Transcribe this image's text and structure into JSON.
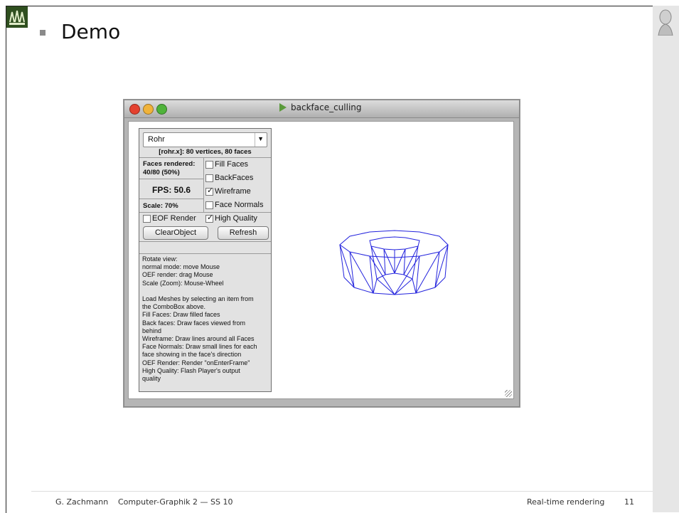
{
  "slide": {
    "title": "Demo",
    "footer": {
      "author": "G. Zachmann",
      "course": "Computer-Graphik 2 — SS 10",
      "topic": "Real-time rendering",
      "page": "11"
    },
    "logos": {
      "left": "university-seal-icon",
      "right": "bust-logo-icon"
    }
  },
  "window": {
    "title": "backface_culling",
    "controls": [
      "close-button",
      "minimize-button",
      "zoom-button"
    ]
  },
  "panel": {
    "combo_value": "Rohr",
    "mesh_info": "[rohr.x]: 80 vertices, 80 faces",
    "faces_rendered_label": "Faces rendered:",
    "faces_rendered_value": "40/80 (50%)",
    "fps": "FPS: 50.6",
    "scale": "Scale: 70%",
    "checkboxes": {
      "fill_faces": {
        "label": "Fill Faces",
        "checked": false
      },
      "back_faces": {
        "label": "BackFaces",
        "checked": false
      },
      "wireframe": {
        "label": "Wireframe",
        "checked": true
      },
      "face_normals": {
        "label": "Face Normals",
        "checked": false
      },
      "eof_render": {
        "label": "EOF Render",
        "checked": false
      },
      "high_quality": {
        "label": "High Quality",
        "checked": true
      }
    },
    "buttons": {
      "clear": "ClearObject",
      "refresh": "Refresh"
    },
    "help_lines": [
      "Rotate view:",
      "normal mode: move Mouse",
      "OEF render:  drag Mouse",
      "Scale (Zoom): Mouse-Wheel",
      "",
      "Load Meshes by selecting an item from",
      "the ComboBox above.",
      "Fill Faces: Draw filled faces",
      "Back faces: Draw faces viewed from",
      "behind",
      "Wireframe: Draw lines around all Faces",
      "Face Normals: Draw small lines for each",
      "face showing in the face's direction",
      "OEF Render: Render \"onEnterFrame\"",
      "High Quality: Flash Player's output",
      "quality"
    ]
  },
  "colors": {
    "wireframe": "#2222dd",
    "tl_close": "#e4412f",
    "tl_min": "#f0b33a",
    "tl_zoom": "#4fb33a"
  }
}
